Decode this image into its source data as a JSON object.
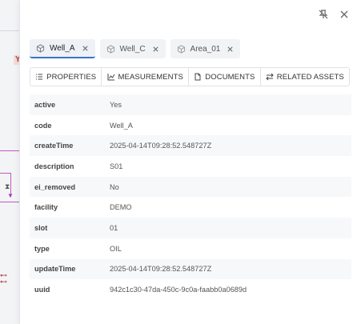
{
  "background": {
    "diagram_label": "Y"
  },
  "panel": {
    "actions": {
      "unpin_icon": "pin-off-icon",
      "close_icon": "close-icon"
    },
    "tabs": [
      {
        "label": "Well_A",
        "active": true
      },
      {
        "label": "Well_C",
        "active": false
      },
      {
        "label": "Area_01",
        "active": false
      }
    ],
    "subtabs": [
      {
        "label": "PROPERTIES",
        "icon": "list-icon"
      },
      {
        "label": "MEASUREMENTS",
        "icon": "chart-icon"
      },
      {
        "label": "DOCUMENTS",
        "icon": "document-icon"
      },
      {
        "label": "RELATED ASSETS",
        "icon": "swap-icon"
      }
    ],
    "properties": [
      {
        "key": "active",
        "value": "Yes"
      },
      {
        "key": "code",
        "value": "Well_A"
      },
      {
        "key": "createTime",
        "value": "2025-04-14T09:28:52.548727Z"
      },
      {
        "key": "description",
        "value": "S01"
      },
      {
        "key": "ei_removed",
        "value": "No"
      },
      {
        "key": "facility",
        "value": "DEMO"
      },
      {
        "key": "slot",
        "value": "01"
      },
      {
        "key": "type",
        "value": "OIL"
      },
      {
        "key": "updateTime",
        "value": "2025-04-14T09:28:52.548727Z"
      },
      {
        "key": "uuid",
        "value": "942c1c30-47da-450c-9c0a-faabb0a0689d"
      }
    ]
  }
}
